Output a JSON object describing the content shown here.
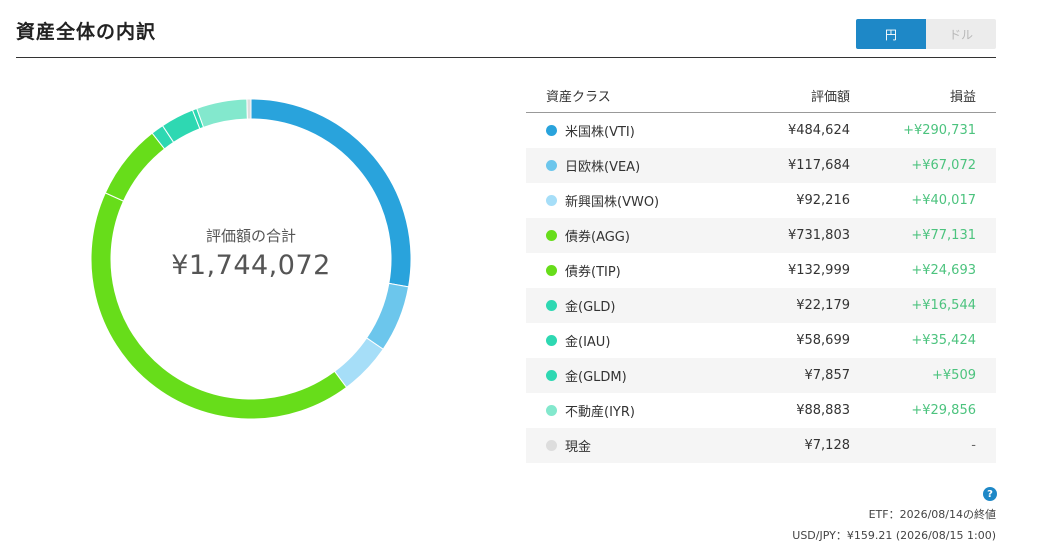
{
  "header": {
    "title": "資産全体の内訳",
    "currency_toggle": [
      {
        "label": "円",
        "active": true
      },
      {
        "label": "ドル",
        "active": false
      }
    ]
  },
  "donut": {
    "center_label": "評価額の合計",
    "total": "¥1,744,072"
  },
  "table": {
    "headers": {
      "name": "資産クラス",
      "value": "評価額",
      "pl": "損益"
    },
    "rows": [
      {
        "name": "米国株(VTI)",
        "value": "¥484,624",
        "pl": "+¥290,731",
        "color": "#29a3dc",
        "amount": 484624
      },
      {
        "name": "日欧株(VEA)",
        "value": "¥117,684",
        "pl": "+¥67,072",
        "color": "#6cc6ec",
        "amount": 117684
      },
      {
        "name": "新興国株(VWO)",
        "value": "¥92,216",
        "pl": "+¥40,017",
        "color": "#a6def8",
        "amount": 92216
      },
      {
        "name": "債券(AGG)",
        "value": "¥731,803",
        "pl": "+¥77,131",
        "color": "#67dd1a",
        "amount": 731803
      },
      {
        "name": "債券(TIP)",
        "value": "¥132,999",
        "pl": "+¥24,693",
        "color": "#67dd1a",
        "amount": 132999
      },
      {
        "name": "金(GLD)",
        "value": "¥22,179",
        "pl": "+¥16,544",
        "color": "#2ed8b2",
        "amount": 22179
      },
      {
        "name": "金(IAU)",
        "value": "¥58,699",
        "pl": "+¥35,424",
        "color": "#2ed8b2",
        "amount": 58699
      },
      {
        "name": "金(GLDM)",
        "value": "¥7,857",
        "pl": "+¥509",
        "color": "#2ed8b2",
        "amount": 7857
      },
      {
        "name": "不動産(IYR)",
        "value": "¥88,883",
        "pl": "+¥29,856",
        "color": "#83e8cd",
        "amount": 88883
      },
      {
        "name": "現金",
        "value": "¥7,128",
        "pl": "-",
        "color": "#dddddd",
        "amount": 7128
      }
    ]
  },
  "footer": {
    "help_icon": "?",
    "etf_note": "ETF：2026/08/14の終値",
    "fx_note": "USD/JPY：¥159.21 (2026/08/15 1:00)"
  }
}
